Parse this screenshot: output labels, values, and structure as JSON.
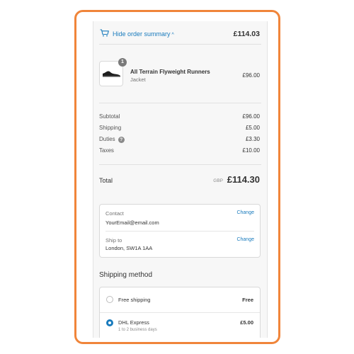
{
  "summary_toggle": {
    "label": "Hide order summary",
    "caret": "^",
    "total": "£114.03"
  },
  "product": {
    "quantity": "1",
    "name": "All Terrain Flyweight Runners",
    "variant": "Jacket",
    "price": "£96.00"
  },
  "costs": {
    "subtotal": {
      "label": "Subtotal",
      "value": "£96.00"
    },
    "shipping": {
      "label": "Shipping",
      "value": "£5.00"
    },
    "duties": {
      "label": "Duties",
      "help": "?",
      "value": "£3.30"
    },
    "taxes": {
      "label": "Taxes",
      "value": "£10.00"
    }
  },
  "total": {
    "label": "Total",
    "currency": "GBP",
    "value": "£114.30"
  },
  "review": {
    "contact": {
      "label": "Contact",
      "value": "YourEmail@email.com",
      "change": "Change"
    },
    "ship_to": {
      "label": "Ship to",
      "value": "London, SW1A 1AA",
      "change": "Change"
    }
  },
  "shipping_method": {
    "heading": "Shipping method",
    "options": [
      {
        "label": "Free shipping",
        "sublabel": "",
        "price": "Free",
        "selected": false
      },
      {
        "label": "DHL Express",
        "sublabel": "1 to 2 business days",
        "price": "£5.00",
        "selected": true
      }
    ]
  },
  "colors": {
    "accent": "#197bbd",
    "frame": "#f0853a"
  },
  "icons": {
    "cart": "cart-icon",
    "help": "help-icon",
    "product_image": "shoe-image"
  }
}
